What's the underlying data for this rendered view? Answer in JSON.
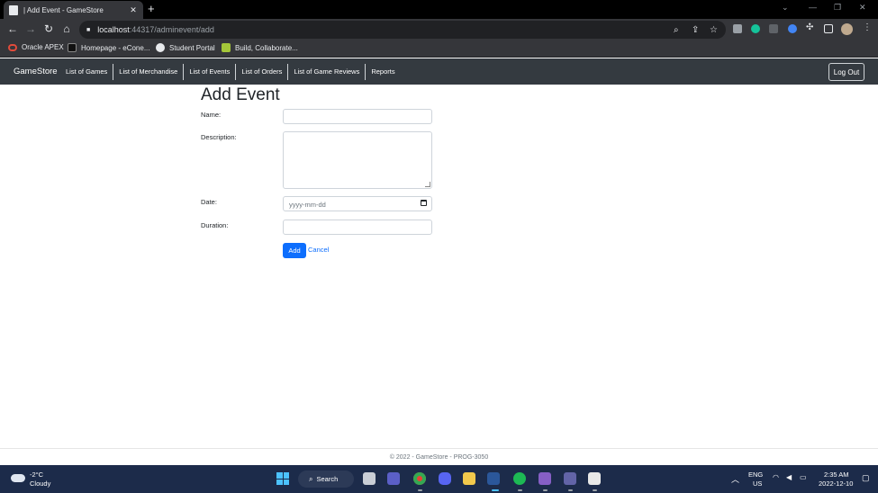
{
  "browser": {
    "tab_title": "| Add Event - GameStore",
    "url_host": "localhost",
    "url_path": ":44317/adminevent/add",
    "bookmarks": [
      {
        "label": "Oracle APEX"
      },
      {
        "label": "Homepage - eCone..."
      },
      {
        "label": "Student Portal"
      },
      {
        "label": "Build, Collaborate..."
      }
    ]
  },
  "navbar": {
    "brand": "GameStore",
    "links": [
      "List of Games",
      "List of Merchandise",
      "List of Events",
      "List of Orders",
      "List of Game Reviews",
      "Reports"
    ],
    "logout_label": "Log Out"
  },
  "page": {
    "title": "Add Event",
    "form": {
      "name_label": "Name:",
      "name_value": "",
      "description_label": "Description:",
      "description_value": "",
      "date_label": "Date:",
      "date_placeholder": "yyyy-mm-dd",
      "duration_label": "Duration:",
      "duration_value": "",
      "add_label": "Add",
      "cancel_label": "Cancel"
    }
  },
  "footer": {
    "text": "© 2022 - GameStore - PROG-3050"
  },
  "taskbar": {
    "weather_temp": "-2°C",
    "weather_desc": "Cloudy",
    "search_label": "Search",
    "lang_line1": "ENG",
    "lang_line2": "US",
    "time": "2:35 AM",
    "date": "2022-12-10"
  },
  "colors": {
    "navbar_bg": "#343a40",
    "primary": "#0d6efd",
    "taskbar_bg": "#1c2b4a"
  }
}
